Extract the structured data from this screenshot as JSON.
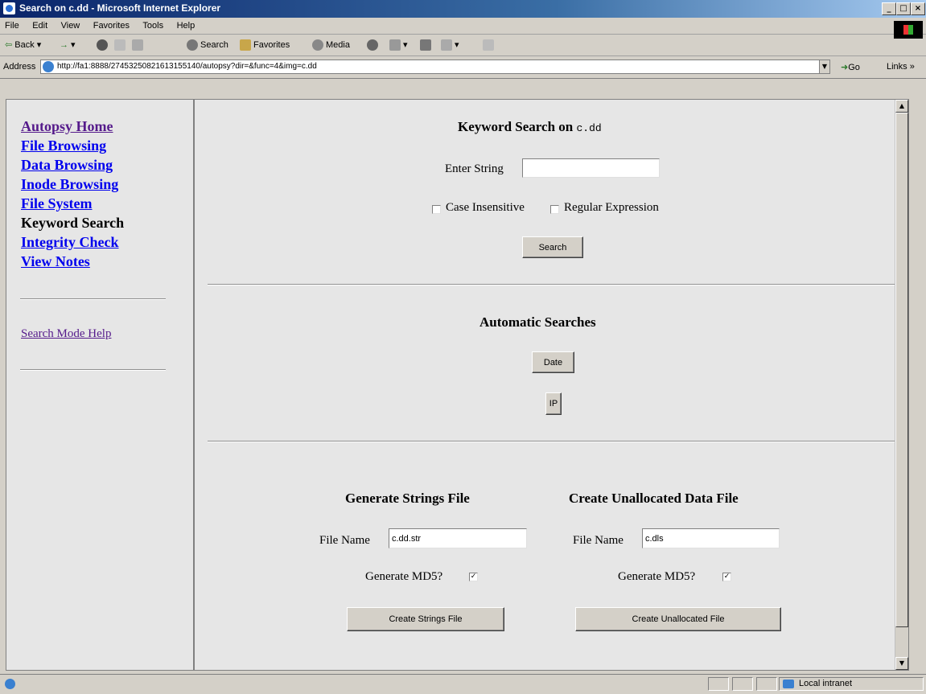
{
  "window": {
    "title": "Search on c.dd - Microsoft Internet Explorer",
    "minimize": "_",
    "maximize": "□",
    "close": "×"
  },
  "menu": [
    "File",
    "Edit",
    "View",
    "Favorites",
    "Tools",
    "Help"
  ],
  "toolbar": {
    "back": "Back",
    "forward": "→",
    "search": "Search",
    "favorites": "Favorites",
    "media": "Media"
  },
  "address": {
    "label": "Address",
    "url": "http://fa1:8888/27453250821613155140/autopsy?dir=&func=4&img=c.dd",
    "go": "Go",
    "links": "Links »"
  },
  "nav": {
    "items": [
      {
        "label": "Autopsy Home",
        "state": "visited"
      },
      {
        "label": "File Browsing",
        "state": "link"
      },
      {
        "label": "Data Browsing",
        "state": "link"
      },
      {
        "label": "Inode Browsing",
        "state": "link"
      },
      {
        "label": "File System",
        "state": "link"
      },
      {
        "label": "Keyword Search",
        "state": "current"
      },
      {
        "label": "Integrity Check",
        "state": "link"
      },
      {
        "label": "View Notes",
        "state": "link"
      }
    ],
    "help_link": "Search Mode Help"
  },
  "keyword_search": {
    "heading": "Keyword Search on",
    "image_name": "c.dd",
    "enter_string_label": "Enter String",
    "enter_string_value": "",
    "case_insensitive_label": "Case Insensitive",
    "case_insensitive_checked": false,
    "regex_label": "Regular Expression",
    "regex_checked": false,
    "search_button": "Search"
  },
  "automatic": {
    "heading": "Automatic Searches",
    "date_button": "Date",
    "ip_button": "IP"
  },
  "strings_file": {
    "heading": "Generate Strings File",
    "file_name_label": "File Name",
    "file_name_value": "c.dd.str",
    "md5_label": "Generate MD5?",
    "md5_checked": true,
    "button": "Create Strings File"
  },
  "unalloc_file": {
    "heading": "Create Unallocated Data File",
    "file_name_label": "File Name",
    "file_name_value": "c.dls",
    "md5_label": "Generate MD5?",
    "md5_checked": true,
    "button": "Create Unallocated File"
  },
  "status": {
    "zone": "Local intranet"
  }
}
